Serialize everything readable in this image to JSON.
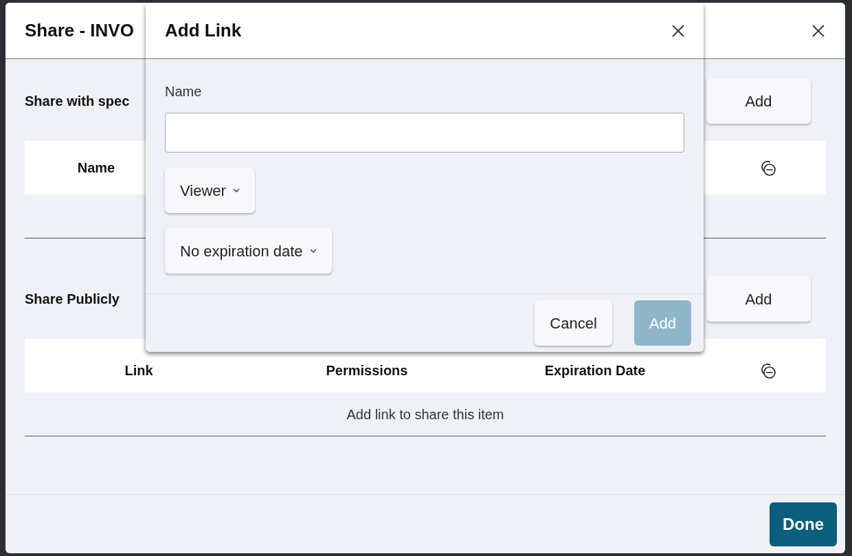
{
  "dialog": {
    "title": "Share - INVO",
    "sections": [
      {
        "heading": "Share with spec",
        "add_button": "Add",
        "columns": [
          "Name"
        ]
      },
      {
        "heading": "Share Publicly",
        "add_button": "Add",
        "columns": [
          "Link",
          "Permissions",
          "Expiration Date"
        ],
        "rows_message": "Add link to share this item"
      }
    ],
    "done_button": "Done"
  },
  "add_link_dialog": {
    "title": "Add Link",
    "field_label": "Name",
    "dropdowns": [
      "Viewer",
      "No expiration date"
    ],
    "buttons": [
      {
        "label": "Cancel",
        "disabled": false
      },
      {
        "label": "Add",
        "disabled": true
      }
    ]
  }
}
